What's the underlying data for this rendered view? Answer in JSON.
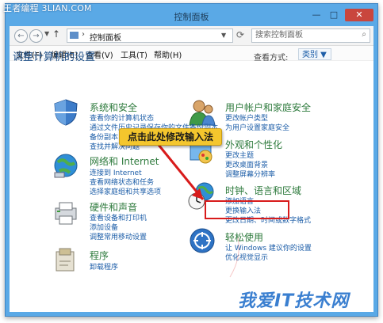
{
  "watermark_top": "王者编程 3LIAN.COM",
  "window": {
    "title": "控制面板",
    "buttons": {
      "minimize": "—",
      "maximize": "□",
      "close": "✕"
    }
  },
  "address": {
    "back": "←",
    "forward": "→",
    "up": "↑",
    "path": "控制面板",
    "separator": "›"
  },
  "search": {
    "placeholder": "搜索控制面板"
  },
  "menu": [
    "文件(F)",
    "编辑(E)",
    "查看(V)",
    "工具(T)",
    "帮助(H)"
  ],
  "heading": "调整计算机的设置",
  "view_by": {
    "label": "查看方式:",
    "value": "类别 ▼"
  },
  "categories": {
    "system": {
      "title": "系统和安全",
      "links": [
        "查看你的计算机状态",
        "通过文件历史记录保存你的文件备份副本",
        "备份副本",
        "查找并解决问题"
      ]
    },
    "network": {
      "title": "网络和 Internet",
      "links": [
        "连接到 Internet",
        "查看网络状态和任务",
        "选择家庭组和共享选项"
      ]
    },
    "hardware": {
      "title": "硬件和声音",
      "links": [
        "查看设备和打印机",
        "添加设备",
        "调整常用移动设置"
      ]
    },
    "programs": {
      "title": "程序",
      "links": [
        "卸载程序"
      ]
    },
    "users": {
      "title": "用户帐户和家庭安全",
      "links": [
        "更改帐户类型",
        "为用户设置家庭安全"
      ]
    },
    "appearance": {
      "title": "外观和个性化",
      "links": [
        "更改主题",
        "更改桌面背景",
        "调整屏幕分辨率"
      ]
    },
    "clock": {
      "title": "时钟、语言和区域",
      "links": [
        "添加语言",
        "更换输入法",
        "更改日期、时间或数字格式"
      ]
    },
    "ease": {
      "title": "轻松使用",
      "links": [
        "让 Windows 建议你的设置",
        "优化视觉显示"
      ]
    }
  },
  "callout": "点击此处修改输入法",
  "watermark_bottom": "我爱IT技术网",
  "colors": {
    "title_blue": "#1d4e87",
    "category_green": "#2d7a3c",
    "link_blue": "#1d5ea8",
    "callout_yellow": "#f4c62d",
    "highlight_red": "#d81b1b"
  }
}
